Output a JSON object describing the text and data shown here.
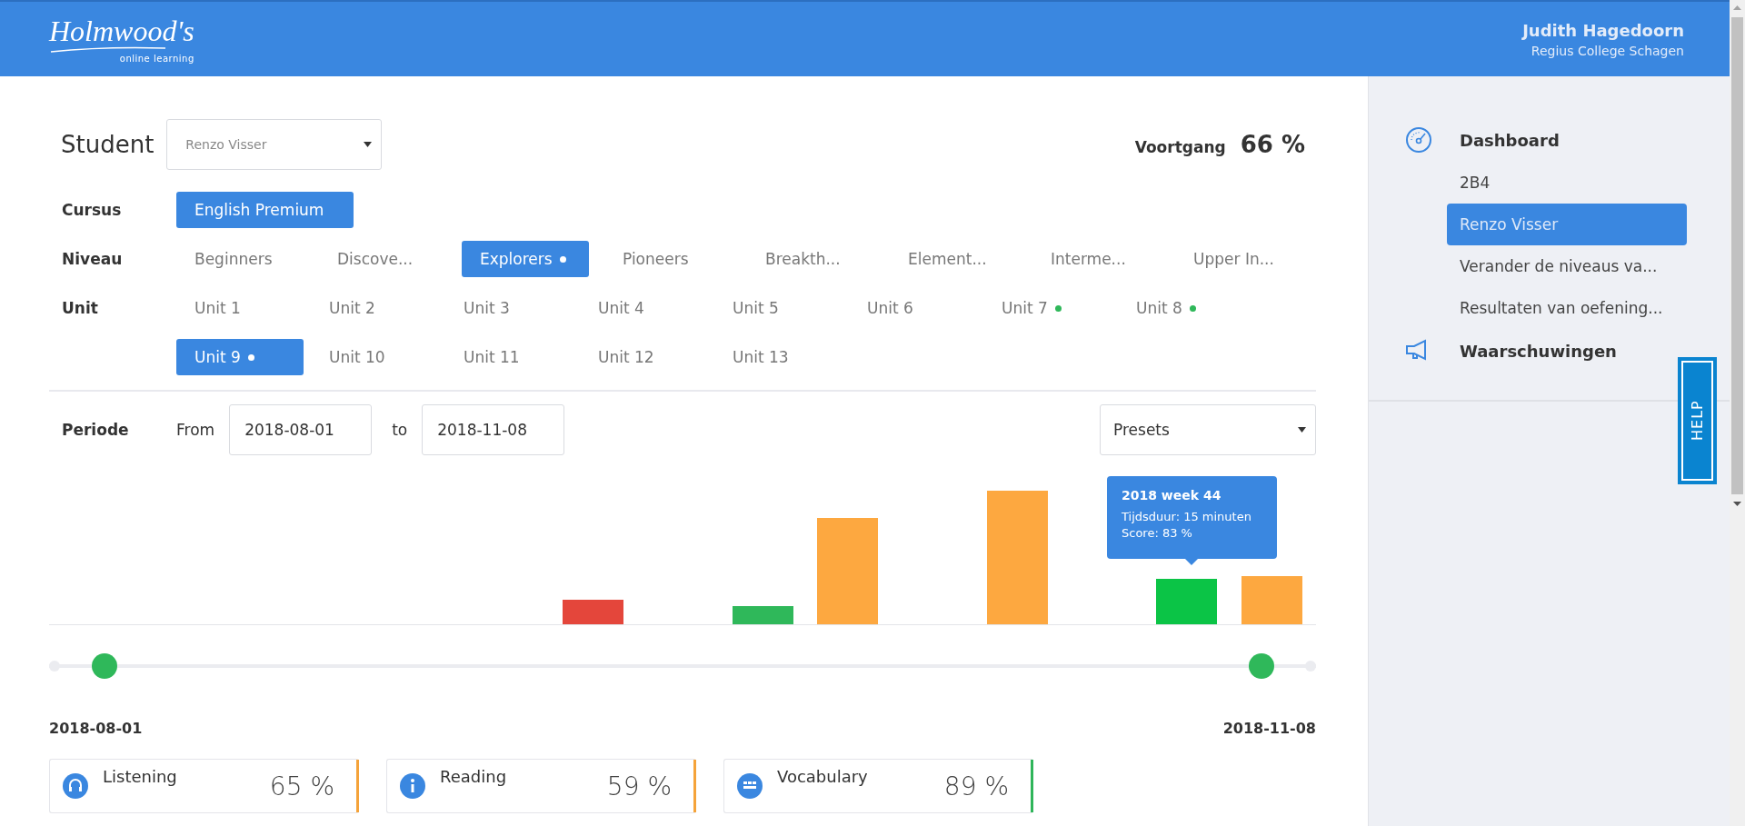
{
  "header": {
    "logo": {
      "title": "Holmwood's",
      "subtitle": "online learning"
    },
    "user": {
      "name": "Judith Hagedoorn",
      "school": "Regius College Schagen"
    }
  },
  "student": {
    "label": "Student",
    "value": "Renzo Visser"
  },
  "progress": {
    "label": "Voortgang",
    "value": "66 %"
  },
  "filters": [
    {
      "label": "Cursus",
      "options": [
        {
          "label": "English Premium",
          "selected": true,
          "completed": false
        }
      ]
    },
    {
      "label": "Niveau",
      "options": [
        {
          "label": "Beginners",
          "selected": false,
          "completed": false
        },
        {
          "label": "Discove...",
          "selected": false,
          "completed": false
        },
        {
          "label": "Explorers",
          "selected": true,
          "completed": true
        },
        {
          "label": "Pioneers",
          "selected": false,
          "completed": false
        },
        {
          "label": "Breakth...",
          "selected": false,
          "completed": false
        },
        {
          "label": "Element...",
          "selected": false,
          "completed": false
        },
        {
          "label": "Interme...",
          "selected": false,
          "completed": false
        },
        {
          "label": "Upper In...",
          "selected": false,
          "completed": false
        }
      ]
    },
    {
      "label": "Unit",
      "options": [
        {
          "label": "Unit 1",
          "selected": false,
          "completed": false
        },
        {
          "label": "Unit 2",
          "selected": false,
          "completed": false
        },
        {
          "label": "Unit 3",
          "selected": false,
          "completed": false
        },
        {
          "label": "Unit 4",
          "selected": false,
          "completed": false
        },
        {
          "label": "Unit 5",
          "selected": false,
          "completed": false
        },
        {
          "label": "Unit 6",
          "selected": false,
          "completed": false
        },
        {
          "label": "Unit 7",
          "selected": false,
          "completed": true
        },
        {
          "label": "Unit 8",
          "selected": false,
          "completed": true
        },
        {
          "label": "Unit 9",
          "selected": true,
          "completed": true
        },
        {
          "label": "Unit 10",
          "selected": false,
          "completed": false
        },
        {
          "label": "Unit 11",
          "selected": false,
          "completed": false
        },
        {
          "label": "Unit 12",
          "selected": false,
          "completed": false
        },
        {
          "label": "Unit 13",
          "selected": false,
          "completed": false
        }
      ]
    }
  ],
  "period": {
    "label": "Periode",
    "from_label": "From",
    "from": "2018-08-01",
    "to_label": "to",
    "to": "2018-11-08",
    "presets": "Presets"
  },
  "chart": {
    "tooltip": {
      "title": "2018 week 44",
      "lines": [
        "Tijdsduur: 15 minuten",
        "Score: 83 %"
      ]
    }
  },
  "range": {
    "handles": [
      {
        "level": 0.044
      },
      {
        "level": 0.957
      }
    ],
    "start_label": "2018-08-01",
    "end_label": "2018-11-08"
  },
  "cards": [
    {
      "kind": "listening",
      "title": "Listening",
      "value": "65 %",
      "color": "#f5a33a"
    },
    {
      "kind": "reading",
      "title": "Reading",
      "value": "59 %",
      "color": "#f5a33a"
    },
    {
      "kind": "vocabulary",
      "title": "Vocabulary",
      "value": "89 %",
      "color": "#2fb55a"
    }
  ],
  "sidebar": {
    "sections": [
      {
        "label": "Dashboard",
        "children": [
          {
            "label": "2B4",
            "selected": false
          },
          {
            "label": "Renzo Visser",
            "selected": true
          },
          {
            "label": "Verander de niveaus va...",
            "selected": false
          },
          {
            "label": "Resultaten van oefening...",
            "selected": false
          }
        ]
      },
      {
        "label": "Waarschuwingen"
      }
    ]
  },
  "help": "HELP"
}
